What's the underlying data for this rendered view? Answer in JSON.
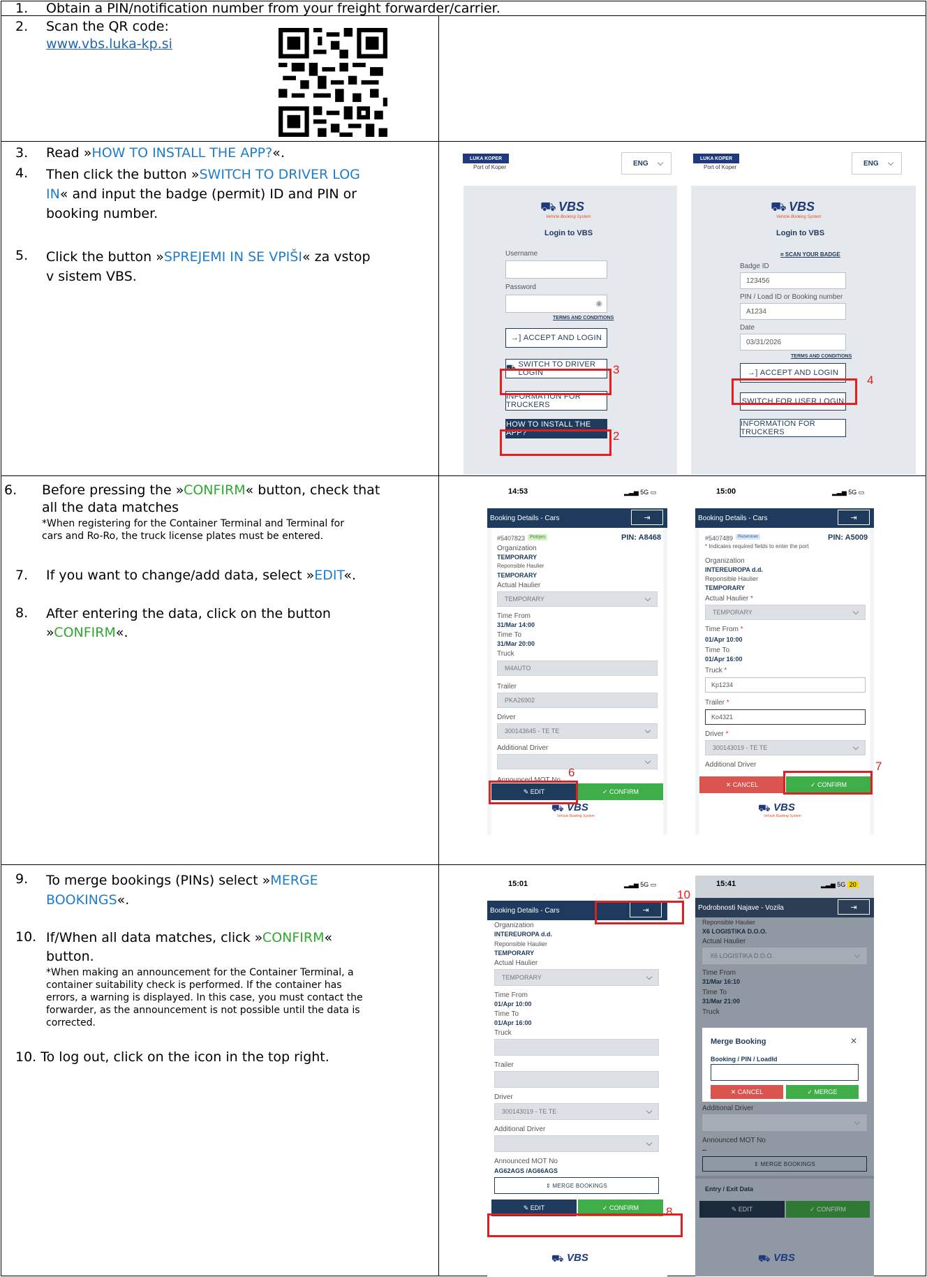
{
  "steps": {
    "s1": {
      "n": "1.",
      "text": "Obtain a PIN/notification number from your freight forwarder/carrier."
    },
    "s2": {
      "n": "2.",
      "text": "Scan the QR code:",
      "link": "www.vbs.luka-kp.si"
    },
    "s3": {
      "n": "3.",
      "pre": "Read »",
      "hl": "HOW TO INSTALL THE APP?",
      "post": "«."
    },
    "s4": {
      "n": "4.",
      "pre": "Then click the button »",
      "hl1": "SWITCH TO DRIVER LOG",
      "hl2": "IN",
      "post": "« and input the badge (permit) ID and PIN or",
      "post2": "booking number."
    },
    "s5": {
      "n": "5.",
      "pre": "Click the button »",
      "hl": "SPREJEMI IN SE VPIŠI",
      "post": "« za vstop",
      "post2": "v sistem VBS."
    },
    "s6": {
      "n": "6.",
      "pre": "Before pressing the »",
      "hl": "CONFIRM",
      "post": "« button, check that",
      "line2": "all the data matches",
      "note1": "*When registering for the Container Terminal and Terminal for",
      "note2": "cars and Ro-Ro, the truck license plates must be entered."
    },
    "s7": {
      "n": "7.",
      "pre": "If you want to change/add data, select »",
      "hl": "EDIT",
      "post": "«."
    },
    "s8": {
      "n": "8.",
      "text": "After entering the data, click on the button",
      "pre2": "»",
      "hl": "CONFIRM",
      "post": "«."
    },
    "s9": {
      "n": "9.",
      "pre": "To merge bookings (PINs) select »",
      "hl1": "MERGE",
      "hl2": "BOOKINGS",
      "post": "«."
    },
    "s10": {
      "n": "10.",
      "pre": "If/When all data matches, click »",
      "hl": "CONFIRM",
      "post": "«",
      "line2": "button.",
      "note1": "*When making an announcement for the Container Terminal, a",
      "note2": "container suitability check is performed. If the container has",
      "note3": "errors, a warning is displayed. In this case, you must contact the",
      "note4": "forwarder, as the announcement is not possible until the data is",
      "note5": "corrected."
    },
    "s11": {
      "text": "10. To log out, click on the icon in the top right."
    }
  },
  "login": {
    "brand": "LUKA KOPER",
    "brand_sub": "Port of Koper",
    "lang": "ENG",
    "vbs": "VBS",
    "vbs_sub": "Vehicle Booking System",
    "title": "Login to VBS",
    "username": "Username",
    "password": "Password",
    "terms": "TERMS AND CONDITIONS",
    "accept": "ACCEPT AND LOGIN",
    "switch_driver": "SWITCH TO DRIVER LOGIN",
    "info": "INFORMATION FOR TRUCKERS",
    "install": "HOW TO INSTALL THE APP?",
    "scan": "SCAN YOUR BADGE",
    "badge": "Badge ID",
    "badge_val": "123456",
    "pin": "PIN / Load ID or Booking number",
    "pin_val": "A1234",
    "date": "Date",
    "date_val": "03/31/2026",
    "switch_user": "SWITCH FOR USER LOGIN"
  },
  "markers": {
    "m2": "2",
    "m3": "3",
    "m4": "4",
    "m6": "6",
    "m7": "7",
    "m8": "8",
    "m10": "10"
  },
  "phone1": {
    "time": "14:53",
    "signal": "5G",
    "title": "Booking Details - Cars",
    "id": "#5407823",
    "badge": "Potrjen",
    "pin": "PIN: A8468",
    "org_l": "Organization",
    "org": "TEMPORARY",
    "resp_l": "Reponsible Haulier",
    "resp": "TEMPORARY",
    "act_l": "Actual Haulier",
    "act": "TEMPORARY",
    "from_l": "Time From",
    "from": "31/Mar 14:00",
    "to_l": "Time To",
    "to": "31/Mar 20:00",
    "truck_l": "Truck",
    "truck": "M4AUTO",
    "trailer_l": "Trailer",
    "trailer": "PKA26902",
    "driver_l": "Driver",
    "driver": "300143645 - TE TE",
    "add_l": "Additional Driver",
    "mot_l": "Announced MOT No",
    "edit": "EDIT",
    "confirm": "CONFIRM"
  },
  "phone2": {
    "time": "15:00",
    "signal": "5G",
    "title": "Booking Details - Cars",
    "id": "#5407489",
    "badge": "Rezerviran",
    "pin": "PIN: A5009",
    "req": "* Indicates required fields to enter the port",
    "org_l": "Organization",
    "org": "INTEREUROPA d.d.",
    "resp_l": "Reponsible Haulier",
    "resp": "TEMPORARY",
    "act_l": "Actual Haulier",
    "act": "TEMPORARY",
    "from_l": "Time From",
    "from": "01/Apr 10:00",
    "to_l": "Time To",
    "to": "01/Apr 16:00",
    "truck_l": "Truck",
    "truck": "Kp1234",
    "trailer_l": "Trailer",
    "trailer": "Ko4321",
    "driver_l": "Driver",
    "driver": "300143019 - TE TE",
    "add_l": "Additional Driver",
    "cancel": "CANCEL",
    "confirm": "CONFIRM"
  },
  "phone3": {
    "time": "15:01",
    "signal": "5G",
    "title": "Booking Details - Cars",
    "org_l": "Organization",
    "org": "INTEREUROPA d.d.",
    "resp_l": "Reponsible Haulier",
    "resp": "TEMPORARY",
    "act_l": "Actual Haulier",
    "act": "TEMPORARY",
    "from_l": "Time From",
    "from": "01/Apr 10:00",
    "to_l": "Time To",
    "to": "01/Apr 16:00",
    "truck_l": "Truck",
    "trailer_l": "Trailer",
    "driver_l": "Driver",
    "driver": "300143019 - TE TE",
    "add_l": "Additional Driver",
    "mot_l": "Announced MOT No",
    "mot": "AG62AGS /AG66AGS",
    "merge": "MERGE BOOKINGS",
    "edit": "EDIT",
    "confirm": "CONFIRM"
  },
  "phone4": {
    "time": "15:41",
    "signal": "5G",
    "battery": "20",
    "title": "Podrobnosti Najave - Vozila",
    "resp_l": "Reponsible Haulier",
    "resp": "X6 LOGISTIKA D.O.O.",
    "act_l": "Actual Haulier",
    "act": "X6 LOGISTIKA D.O.O.",
    "from_l": "Time From",
    "from": "31/Mar 16:10",
    "to_l": "Time To",
    "to": "31/Mar 21:00",
    "truck_l": "Truck",
    "modal_title": "Merge Booking",
    "modal_field": "Booking / PIN / LoadId",
    "cancel": "CANCEL",
    "merge": "MERGE",
    "add_l": "Additional Driver",
    "mot_l": "Announced MOT No",
    "mot": "--",
    "merge_btn": "MERGE BOOKINGS",
    "entry": "Entry / Exit Data",
    "edit": "EDIT",
    "confirm": "CONFIRM"
  }
}
